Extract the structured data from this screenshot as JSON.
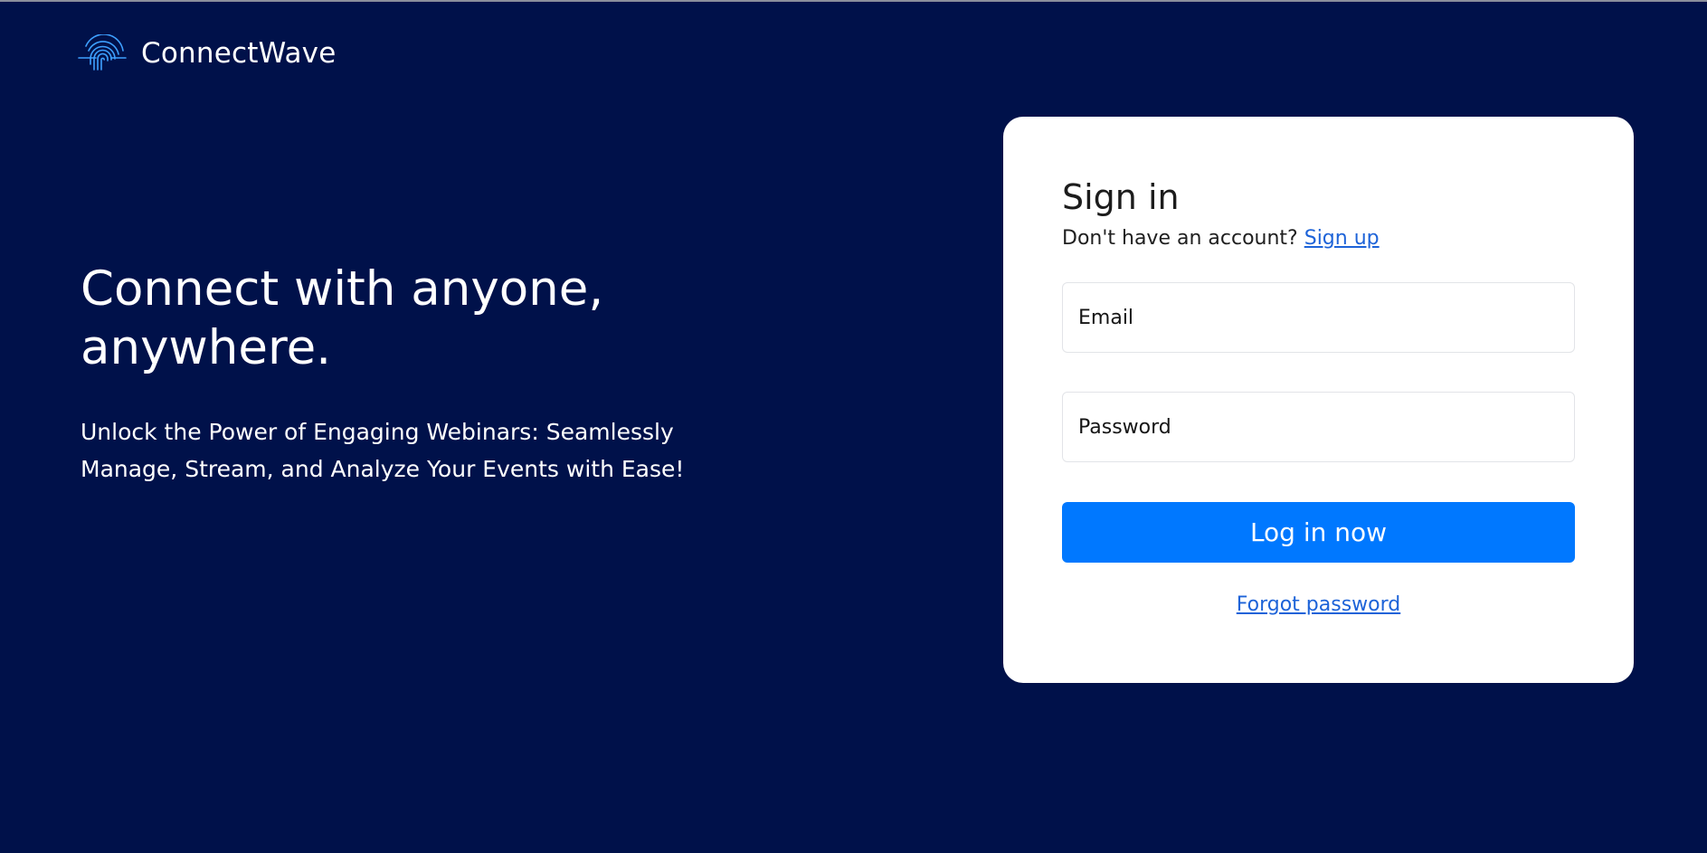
{
  "brand": {
    "name": "ConnectWave",
    "logo_icon": "wave-fingerprint-icon",
    "logo_color": "#3ea0ff"
  },
  "hero": {
    "title": "Connect with anyone, anywhere.",
    "subtitle": "Unlock the Power of Engaging Webinars: Seamlessly Manage, Stream, and Analyze Your Events with Ease!"
  },
  "signin": {
    "title": "Sign in",
    "no_account_text": "Don't have an account?",
    "signup_link": "Sign up",
    "email_placeholder": "Email",
    "email_value": "",
    "password_placeholder": "Password",
    "password_value": "",
    "login_button": "Log in now",
    "forgot_link": "Forgot password"
  },
  "colors": {
    "background": "#00114a",
    "card": "#ffffff",
    "primary_button": "#0078ff",
    "link": "#1d63d8"
  }
}
